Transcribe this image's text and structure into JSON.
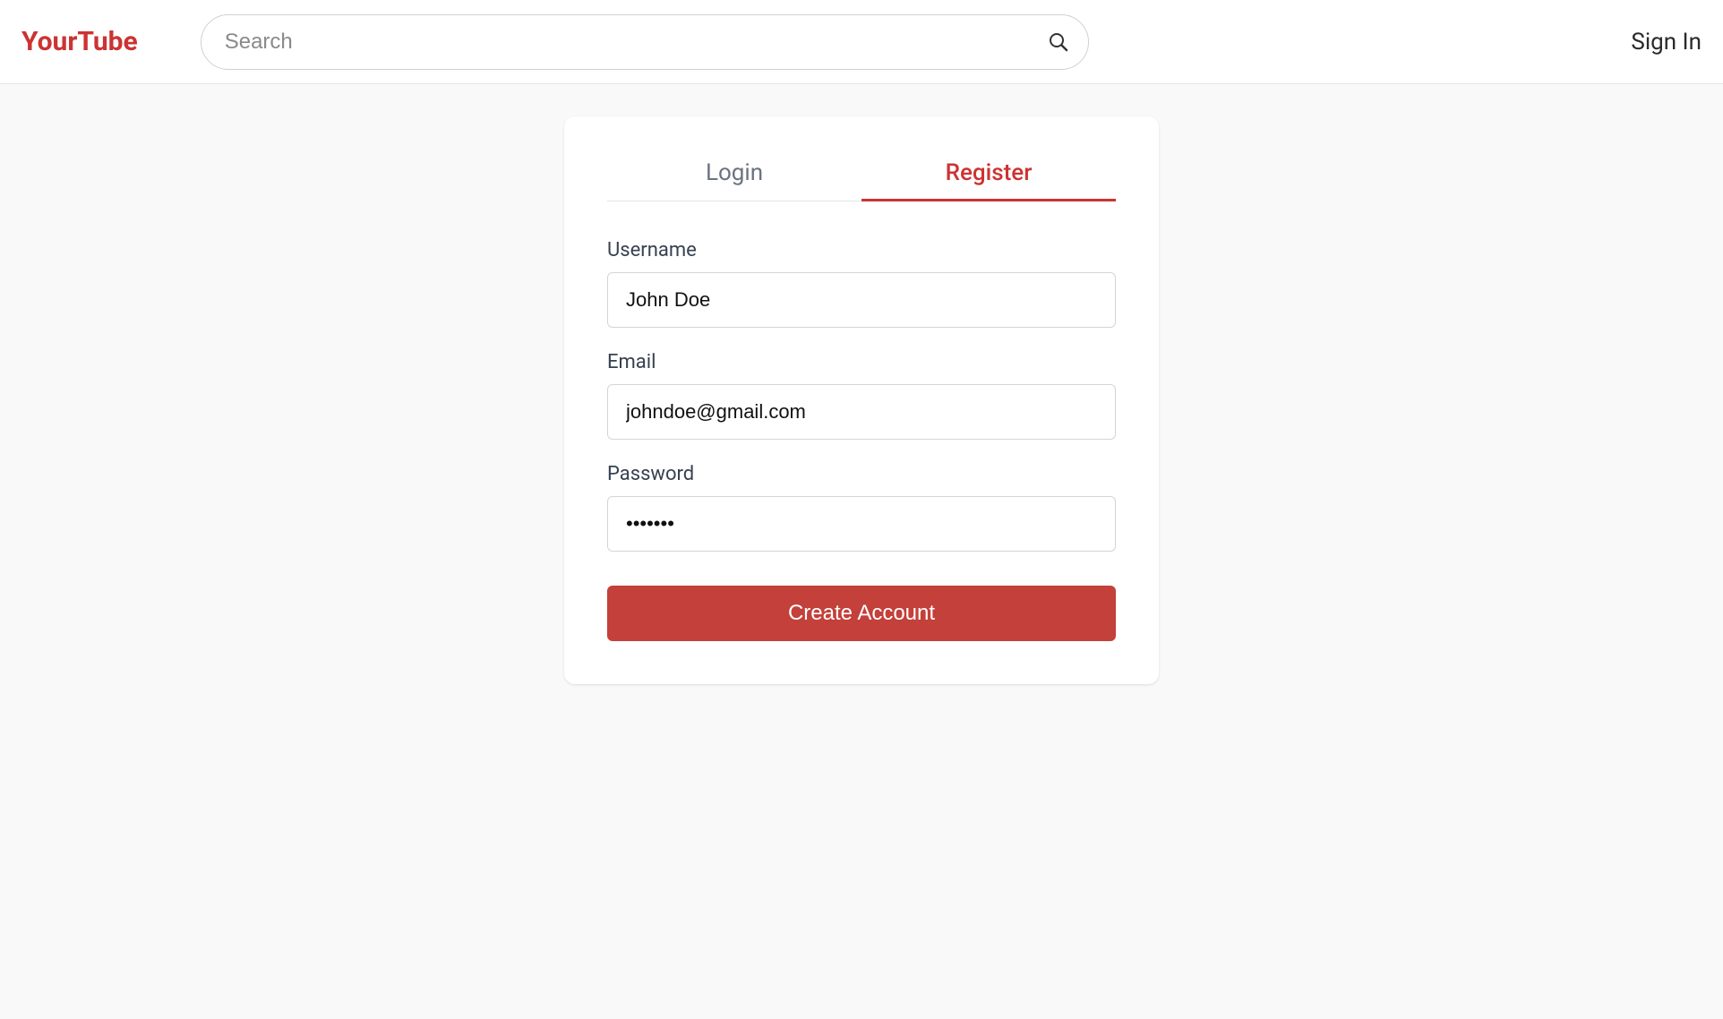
{
  "header": {
    "logo": "YourTube",
    "search_placeholder": "Search",
    "search_value": "",
    "signin_label": "Sign In"
  },
  "auth_card": {
    "tabs": {
      "login": "Login",
      "register": "Register"
    },
    "fields": {
      "username": {
        "label": "Username",
        "value": "John Doe"
      },
      "email": {
        "label": "Email",
        "value": "johndoe@gmail.com"
      },
      "password": {
        "label": "Password",
        "value": "•••••••"
      }
    },
    "submit_label": "Create Account"
  }
}
